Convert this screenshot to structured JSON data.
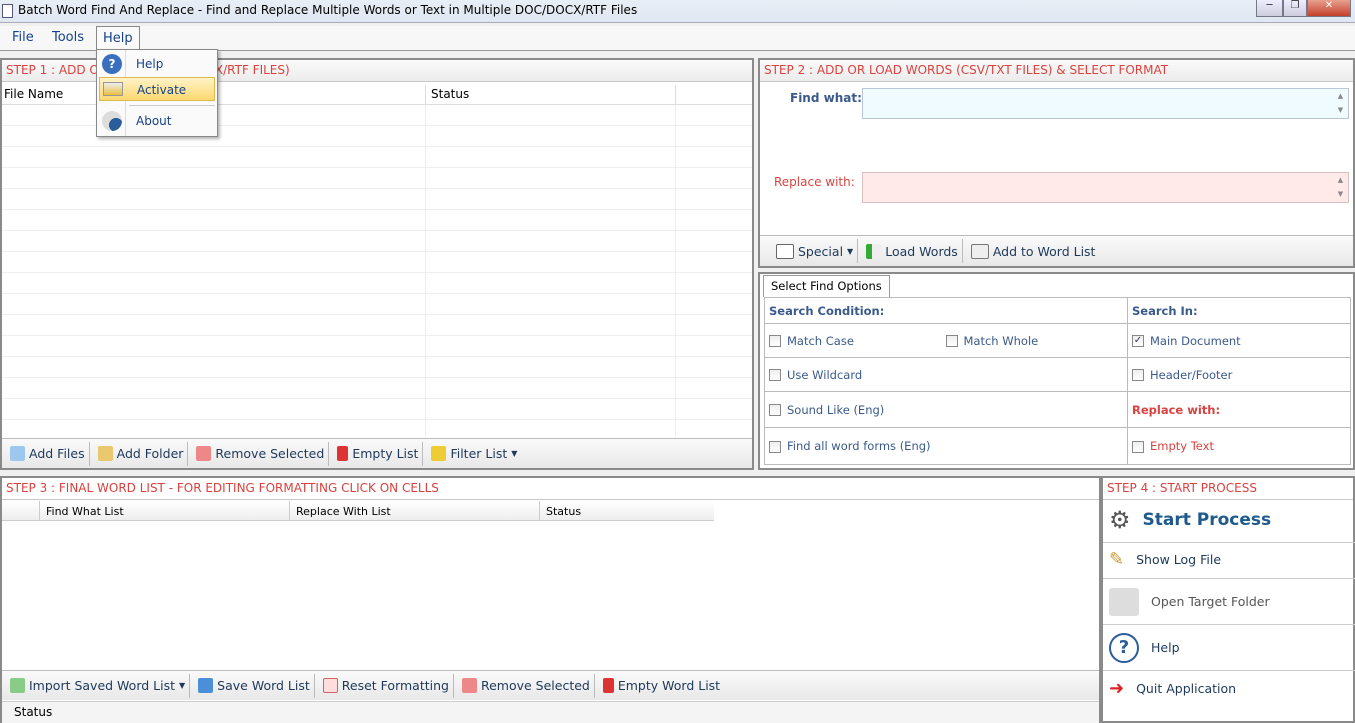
{
  "window": {
    "title": "Batch Word Find And Replace - Find and Replace Multiple Words or Text  in Multiple DOC/DOCX/RTF Files",
    "minimize": "─",
    "maximize": "❐",
    "close": "✕"
  },
  "menu": {
    "items": [
      "File",
      "Tools",
      "Help"
    ],
    "open": "Help",
    "help_menu": [
      "Help",
      "Activate",
      "About"
    ],
    "highlighted": "Activate"
  },
  "step1": {
    "title": "STEP 1 : ADD OR LOAD DOC/DOCX/RTF FILES)",
    "title_visible_left": "STEP 1 : ADD O",
    "title_visible_right": "DOCX/RTF FILES)",
    "columns": [
      "File Name",
      "Status"
    ],
    "toolbar": [
      "Add Files",
      "Add Folder",
      "Remove Selected",
      "Empty List",
      "Filter List"
    ]
  },
  "step2": {
    "title": "STEP 2 : ADD OR LOAD WORDS (CSV/TXT FILES) & SELECT FORMAT",
    "find_label": "Find what:",
    "find_value": "",
    "replace_label": "Replace with:",
    "replace_value": "",
    "toolbar": [
      "Special",
      "Load Words",
      "Add to Word List"
    ]
  },
  "options": {
    "tab": "Select Find Options",
    "search_condition": "Search Condition:",
    "search_in": "Search In:",
    "replace_with": "Replace with:",
    "match_case": {
      "label": "Match Case",
      "checked": false
    },
    "match_whole": {
      "label": "Match Whole",
      "checked": false
    },
    "wildcard": {
      "label": "Use Wildcard",
      "checked": false
    },
    "sound_like": {
      "label": "Sound Like (Eng)",
      "checked": false
    },
    "word_forms": {
      "label": "Find all word forms (Eng)",
      "checked": false
    },
    "main_doc": {
      "label": "Main Document",
      "checked": true
    },
    "header_footer": {
      "label": "Header/Footer",
      "checked": false
    },
    "empty_text": {
      "label": "Empty Text",
      "checked": false
    }
  },
  "step3": {
    "title": "STEP 3 : FINAL WORD LIST - FOR EDITING FORMATTING CLICK ON CELLS",
    "columns": [
      "Find What List",
      "Replace With List",
      "Status"
    ],
    "toolbar": [
      "Import Saved Word List",
      "Save Word List",
      "Reset Formatting",
      "Remove Selected",
      "Empty Word List"
    ],
    "status": "Status"
  },
  "step4": {
    "title": "STEP 4 : START PROCESS",
    "items": [
      "Start Process",
      "Show Log File",
      "Open Target Folder",
      "Help",
      "Quit Application"
    ]
  },
  "colors": {
    "accent_red": "#d9423e",
    "text_blue": "#1e395b",
    "find_bg": "#effbff",
    "replace_bg": "#ffe9e9",
    "menu_highlight": "#fbe38c"
  }
}
